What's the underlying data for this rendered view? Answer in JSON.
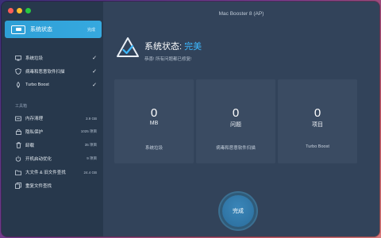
{
  "colors": {
    "red": "#ff5f57",
    "yellow": "#febc2e",
    "green": "#28c840",
    "accent": "#36a9df"
  },
  "window": {
    "title": "Mac Booster 8 (AP)"
  },
  "sidebar": {
    "selected": {
      "label": "系统状态",
      "badge": "完成",
      "icon": "monitor-icon"
    },
    "items": [
      {
        "label": "系统垃圾",
        "icon": "monitor-icon",
        "status": "✓"
      },
      {
        "label": "病毒和恶意软件扫描",
        "icon": "shield-icon",
        "status": "✓"
      },
      {
        "label": "Turbo Boost",
        "icon": "rocket-icon",
        "status": "✓"
      }
    ],
    "section": "工具箱",
    "tools": [
      {
        "label": "内存清理",
        "icon": "memory-icon",
        "value": "3.9 GB"
      },
      {
        "label": "隐私保护",
        "icon": "lock-icon",
        "value": "1025 项目"
      },
      {
        "label": "卸载",
        "icon": "trash-icon",
        "value": "35 项目"
      },
      {
        "label": "开机启动优化",
        "icon": "power-icon",
        "value": "9 项目"
      },
      {
        "label": "大文件 & 旧文件查找",
        "icon": "folder-icon",
        "value": "24.4 GB"
      },
      {
        "label": "重复文件查找",
        "icon": "duplicate-icon",
        "value": ""
      }
    ]
  },
  "status": {
    "heading": "系统状态:",
    "highlight": "完美",
    "subtitle": "恭喜! 所有问题都已修复!"
  },
  "cards": [
    {
      "number": "0",
      "unit": "MB",
      "label": "系统垃圾"
    },
    {
      "number": "0",
      "unit": "问题",
      "label": "病毒和恶意软件扫描"
    },
    {
      "number": "0",
      "unit": "项目",
      "label": "Turbo Boost"
    }
  ],
  "done_button": "完成"
}
